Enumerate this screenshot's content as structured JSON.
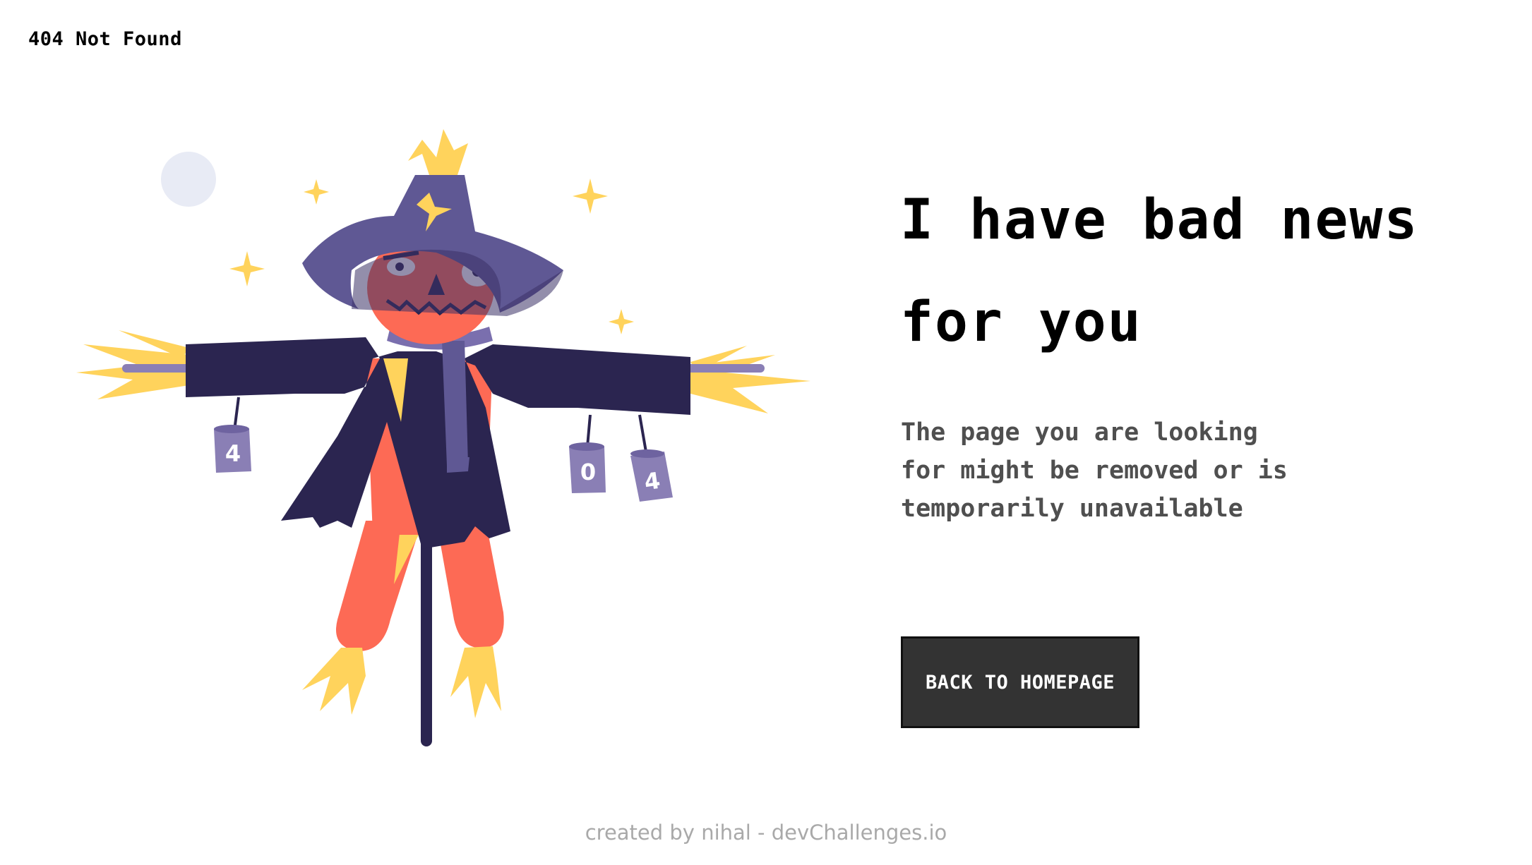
{
  "header": {
    "site_title": "404 Not Found"
  },
  "illustration": {
    "icon": "scarecrow-illustration",
    "can_labels": [
      "4",
      "0",
      "4"
    ]
  },
  "main": {
    "headline": "I have bad news for you",
    "description": "The page you are looking for might be removed or is temporarily unavailable",
    "back_button_label": "BACK TO HOMEPAGE"
  },
  "footer": {
    "credit": "created by nihal - devChallenges.io"
  },
  "colors": {
    "button_bg": "#333333",
    "text": "#000000",
    "description_text": "#4f4f4f",
    "footer_text": "#a9a9a9",
    "hat": "#5f5894",
    "coat": "#2b2550",
    "body": "#fd6a55",
    "straw": "#ffd35c"
  }
}
